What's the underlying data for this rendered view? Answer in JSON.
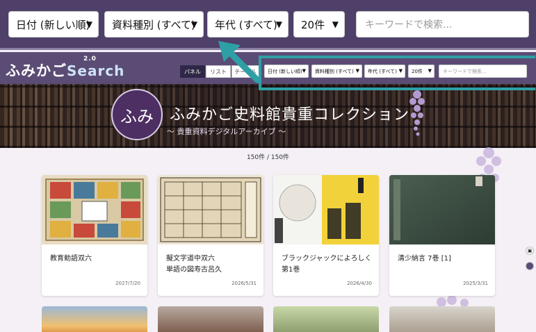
{
  "zoom_toolbar": {
    "sort_select": "日付 (新しい順)",
    "type_select": "資料種別 (すべて)",
    "era_select": "年代 (すべて)",
    "count_select": "20件",
    "search_placeholder": "キーワードで検索..."
  },
  "header": {
    "logo_text": "ふみかご",
    "logo_search": "Search",
    "logo_version": "2.0",
    "view_buttons": [
      "パネル",
      "リスト",
      "テーブル"
    ],
    "sort_select": "日付 (新しい順)",
    "type_select": "資料種別 (すべて)",
    "era_select": "年代 (すべて)",
    "count_select": "20件",
    "search_placeholder": "キーワードで検索..."
  },
  "hero": {
    "seal_text": "ふみ",
    "title": "ふみかご史料館貴重コレクション",
    "subtitle": "〜 貴重資料デジタルアーカイブ 〜"
  },
  "result_count": "150件 / 150件",
  "cards": [
    {
      "title": "教育勅語双六",
      "date": "2027/7/20"
    },
    {
      "title": "擬文字道中双六\n単語の図寿古呂久",
      "date": "2026/5/31"
    },
    {
      "title": "ブラックジャックによろしく\n第1巻",
      "date": "2026/4/30"
    },
    {
      "title": "清少納言 7巻 [1]",
      "date": "2025/3/31"
    }
  ],
  "colors": {
    "header_bg": "#5b4c75",
    "zoom_bg": "#4e4068",
    "highlight": "#2f9fa6",
    "page_bg": "#f4f0f6"
  }
}
